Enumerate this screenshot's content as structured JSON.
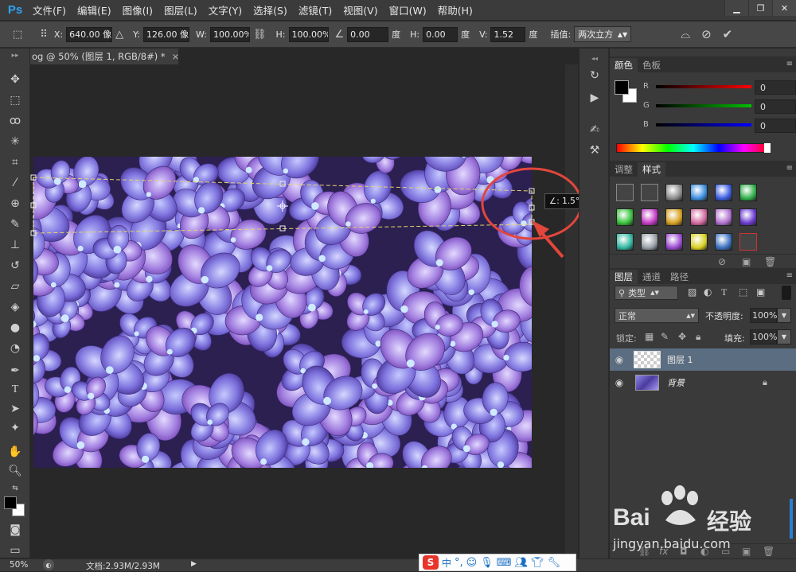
{
  "app": {
    "logo": "Ps"
  },
  "menu": [
    "文件(F)",
    "编辑(E)",
    "图像(I)",
    "图层(L)",
    "文字(Y)",
    "选择(S)",
    "滤镜(T)",
    "视图(V)",
    "窗口(W)",
    "帮助(H)"
  ],
  "options": {
    "x_label": "X:",
    "x_value": "640.00 像素",
    "y_label": "Y:",
    "y_value": "126.00 像素",
    "w_label": "W:",
    "w_value": "100.00%",
    "h_label": "H:",
    "h_value": "100.00%",
    "rot_value": "0.00",
    "rot_unit": "度",
    "hskew_label": "H:",
    "hskew_value": "0.00",
    "hskew_unit": "度",
    "vskew_label": "V:",
    "vskew_value": "1.52",
    "vskew_unit": "度",
    "interp_label": "插值:",
    "interp_value": "两次立方"
  },
  "document": {
    "tab_title": "og @ 50% (图层 1, RGB/8#) *",
    "close": "×"
  },
  "transform": {
    "angle_label": "∠: 1.5°"
  },
  "status": {
    "zoom": "50%",
    "doc_info": "文档:2.93M/2.93M"
  },
  "color_panel": {
    "tabs": [
      "颜色",
      "色板"
    ],
    "channels": [
      {
        "label": "R",
        "value": "0",
        "color": "#ff0000"
      },
      {
        "label": "G",
        "value": "0",
        "color": "#00c000"
      },
      {
        "label": "B",
        "value": "0",
        "color": "#0000ff"
      }
    ]
  },
  "styles_panel": {
    "tabs": [
      "调整",
      "样式"
    ]
  },
  "layers_panel": {
    "tabs": [
      "图层",
      "通道",
      "路径"
    ],
    "filter_label": "类型",
    "blend_mode": "正常",
    "opacity_label": "不透明度:",
    "opacity_value": "100%",
    "lock_label": "锁定:",
    "fill_label": "填充:",
    "fill_value": "100%",
    "layers": [
      {
        "name": "图层 1",
        "selected": true
      },
      {
        "name": "背景",
        "selected": false,
        "locked": true
      }
    ]
  },
  "ime": {
    "logo": "S",
    "lang": "中"
  },
  "watermark": {
    "brand": "Bai",
    "brand2": "经验",
    "url": "jingyan.baidu.com"
  }
}
